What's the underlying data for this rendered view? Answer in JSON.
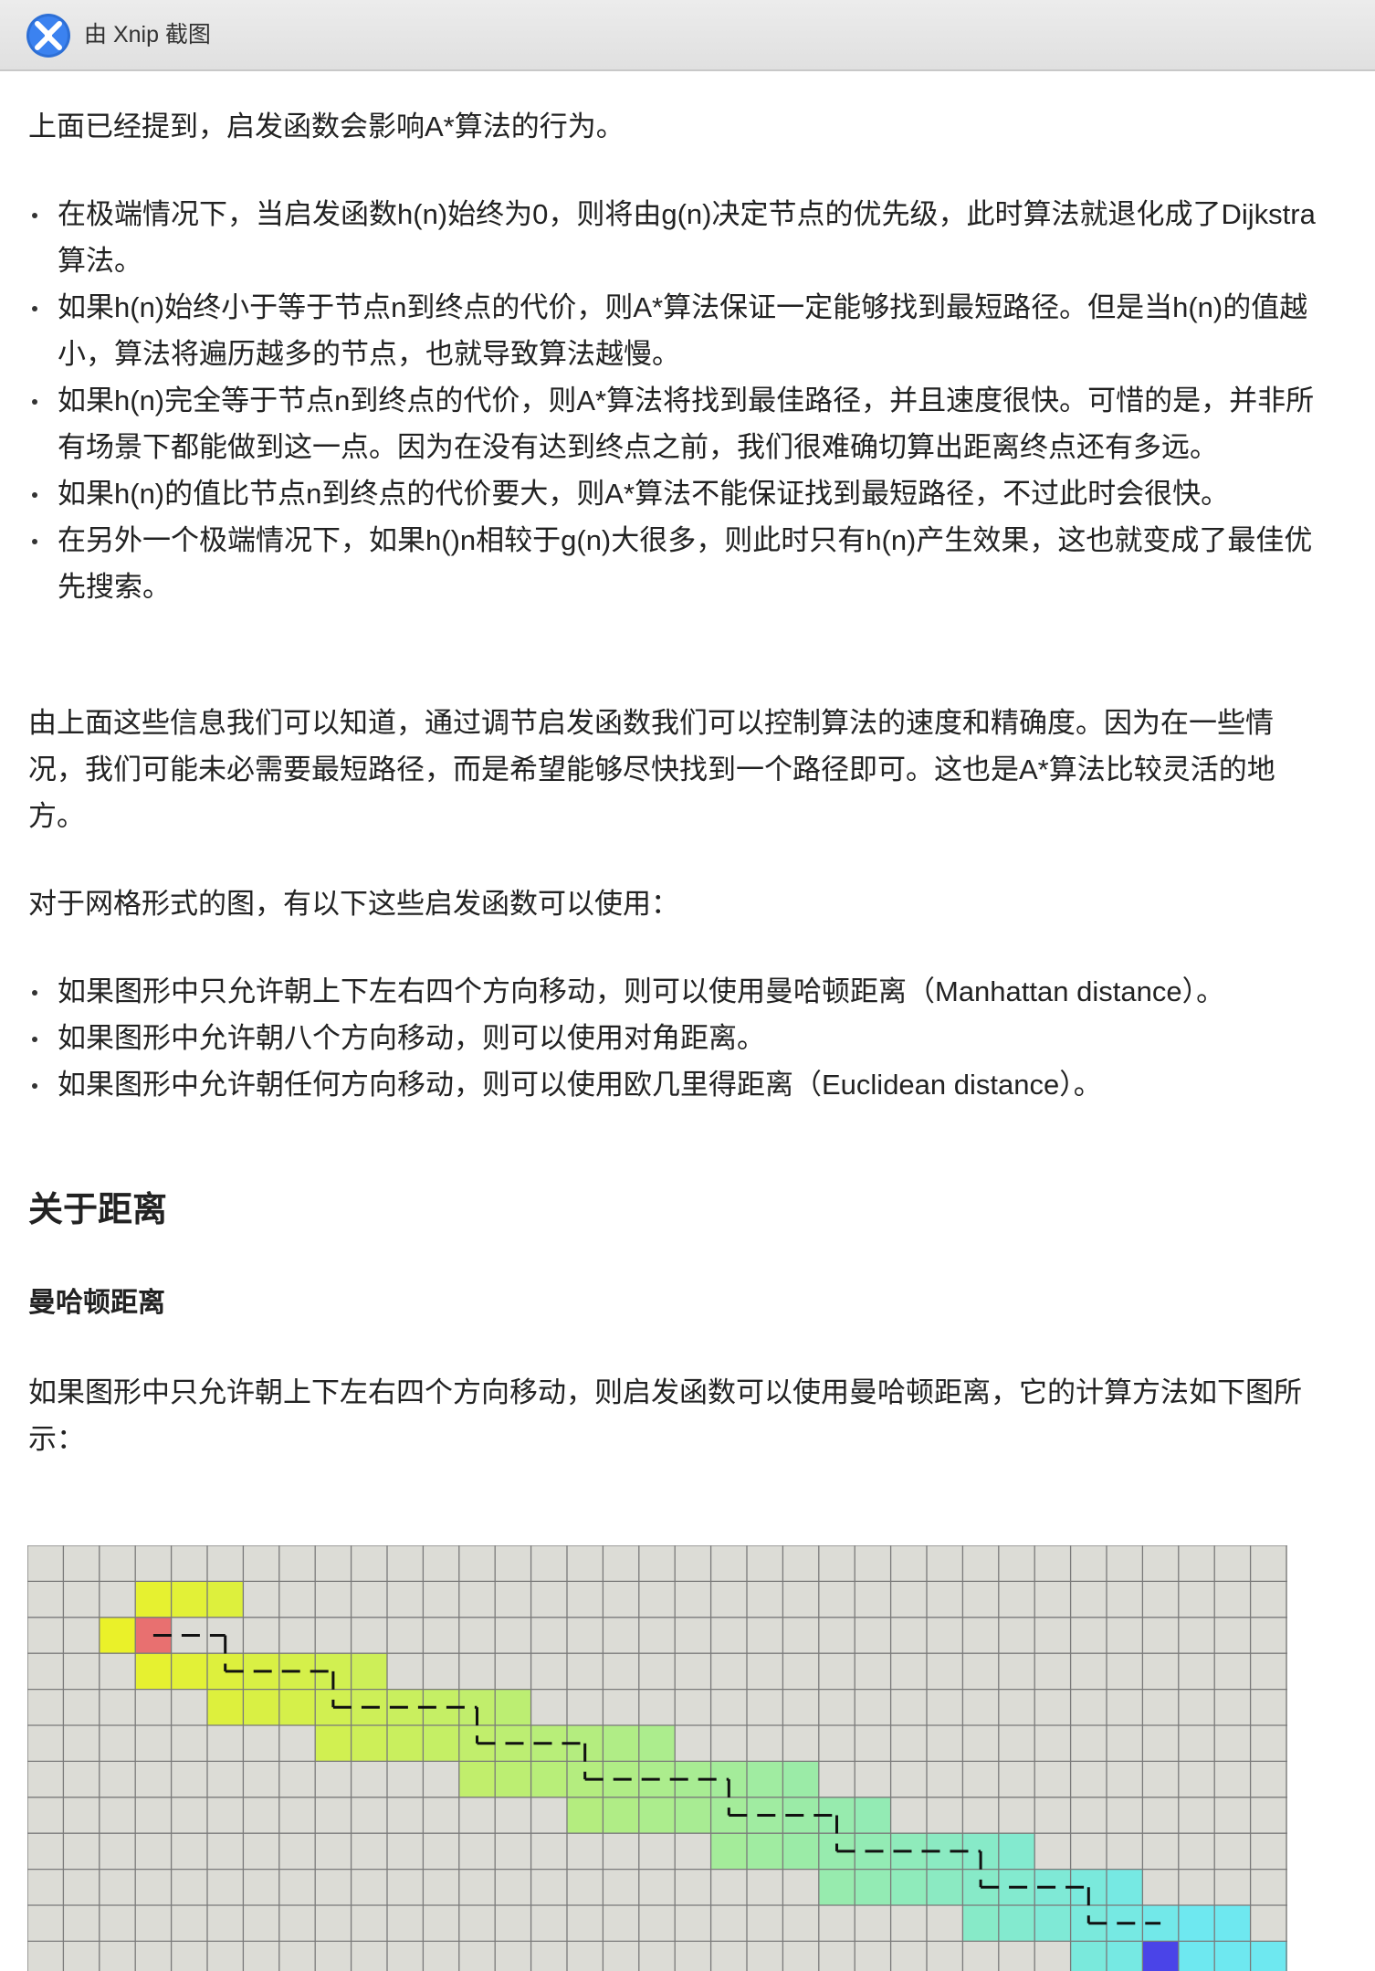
{
  "titlebar": {
    "title": "由 Xnip 截图",
    "icon": "xnip-app-icon"
  },
  "article": {
    "intro": "上面已经提到，启发函数会影响A*算法的行为。",
    "cases": [
      "在极端情况下，当启发函数h(n)始终为0，则将由g(n)决定节点的优先级，此时算法就退化成了Dijkstra算法。",
      "如果h(n)始终小于等于节点n到终点的代价，则A*算法保证一定能够找到最短路径。但是当h(n)的值越小，算法将遍历越多的节点，也就导致算法越慢。",
      "如果h(n)完全等于节点n到终点的代价，则A*算法将找到最佳路径，并且速度很快。可惜的是，并非所有场景下都能做到这一点。因为在没有达到终点之前，我们很难确切算出距离终点还有多远。",
      "如果h(n)的值比节点n到终点的代价要大，则A*算法不能保证找到最短路径，不过此时会很快。",
      "在另外一个极端情况下，如果h()n相较于g(n)大很多，则此时只有h(n)产生效果，这也就变成了最佳优先搜索。"
    ],
    "summary": "由上面这些信息我们可以知道，通过调节启发函数我们可以控制算法的速度和精确度。因为在一些情况，我们可能未必需要最短路径，而是希望能够尽快找到一个路径即可。这也是A*算法比较灵活的地方。",
    "grid_intro": "对于网格形式的图，有以下这些启发函数可以使用：",
    "heuristics": [
      "如果图形中只允许朝上下左右四个方向移动，则可以使用曼哈顿距离（Manhattan distance）。",
      "如果图形中允许朝八个方向移动，则可以使用对角距离。",
      "如果图形中允许朝任何方向移动，则可以使用欧几里得距离（Euclidean distance）。"
    ],
    "section_heading": "关于距离",
    "subsection_heading": "曼哈顿距离",
    "manhattan_text": "如果图形中只允许朝上下左右四个方向移动，则启发函数可以使用曼哈顿距离，它的计算方法如下图所示："
  },
  "figure": {
    "grid_color": "#dcdcd6",
    "line_color": "#7a7a7a",
    "start_color": "#e87070",
    "goal_color": "#4a44e8",
    "explored_from": "#f2f21c",
    "explored_to": "#6ee8f0",
    "path_color": "#111111"
  }
}
